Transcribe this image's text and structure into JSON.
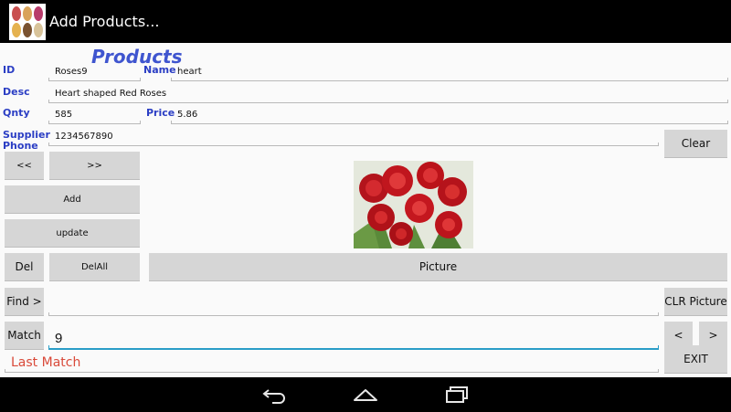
{
  "app": {
    "title": "Add Products..."
  },
  "form": {
    "section_title": "Products",
    "id_label": "ID",
    "id_value": "Roses9",
    "name_label": "Name",
    "name_value": "heart",
    "desc_label": "Desc",
    "desc_value": "Heart shaped Red Roses",
    "qnty_label": "Qnty",
    "qnty_value": "585",
    "price_label": "Price",
    "price_value": "5.86",
    "supplier_label_line1": "Supplier",
    "supplier_label_line2": "Phone",
    "supplier_value": "1234567890"
  },
  "buttons": {
    "clear": "Clear",
    "prev_record": "<<",
    "next_record": ">>",
    "add": "Add",
    "update": "update",
    "del": "Del",
    "del_all": "DelAll",
    "picture": "Picture",
    "find": "Find >",
    "clr_picture": "CLR Picture",
    "match": "Match",
    "prev_match": "<",
    "next_match": ">",
    "exit": "EXIT"
  },
  "search": {
    "find_value": "",
    "match_value": "9",
    "status_text": "Last Match"
  },
  "image": {
    "subject": "red roses"
  },
  "nav": {
    "icons": [
      "back-icon",
      "home-icon",
      "recents-icon"
    ]
  },
  "colors": {
    "label_blue": "#2b3ec4",
    "title_blue": "#3f55cf",
    "status_red": "#d94a3a",
    "focus_blue": "#2a9dc7",
    "button_gray": "#d6d6d6"
  }
}
